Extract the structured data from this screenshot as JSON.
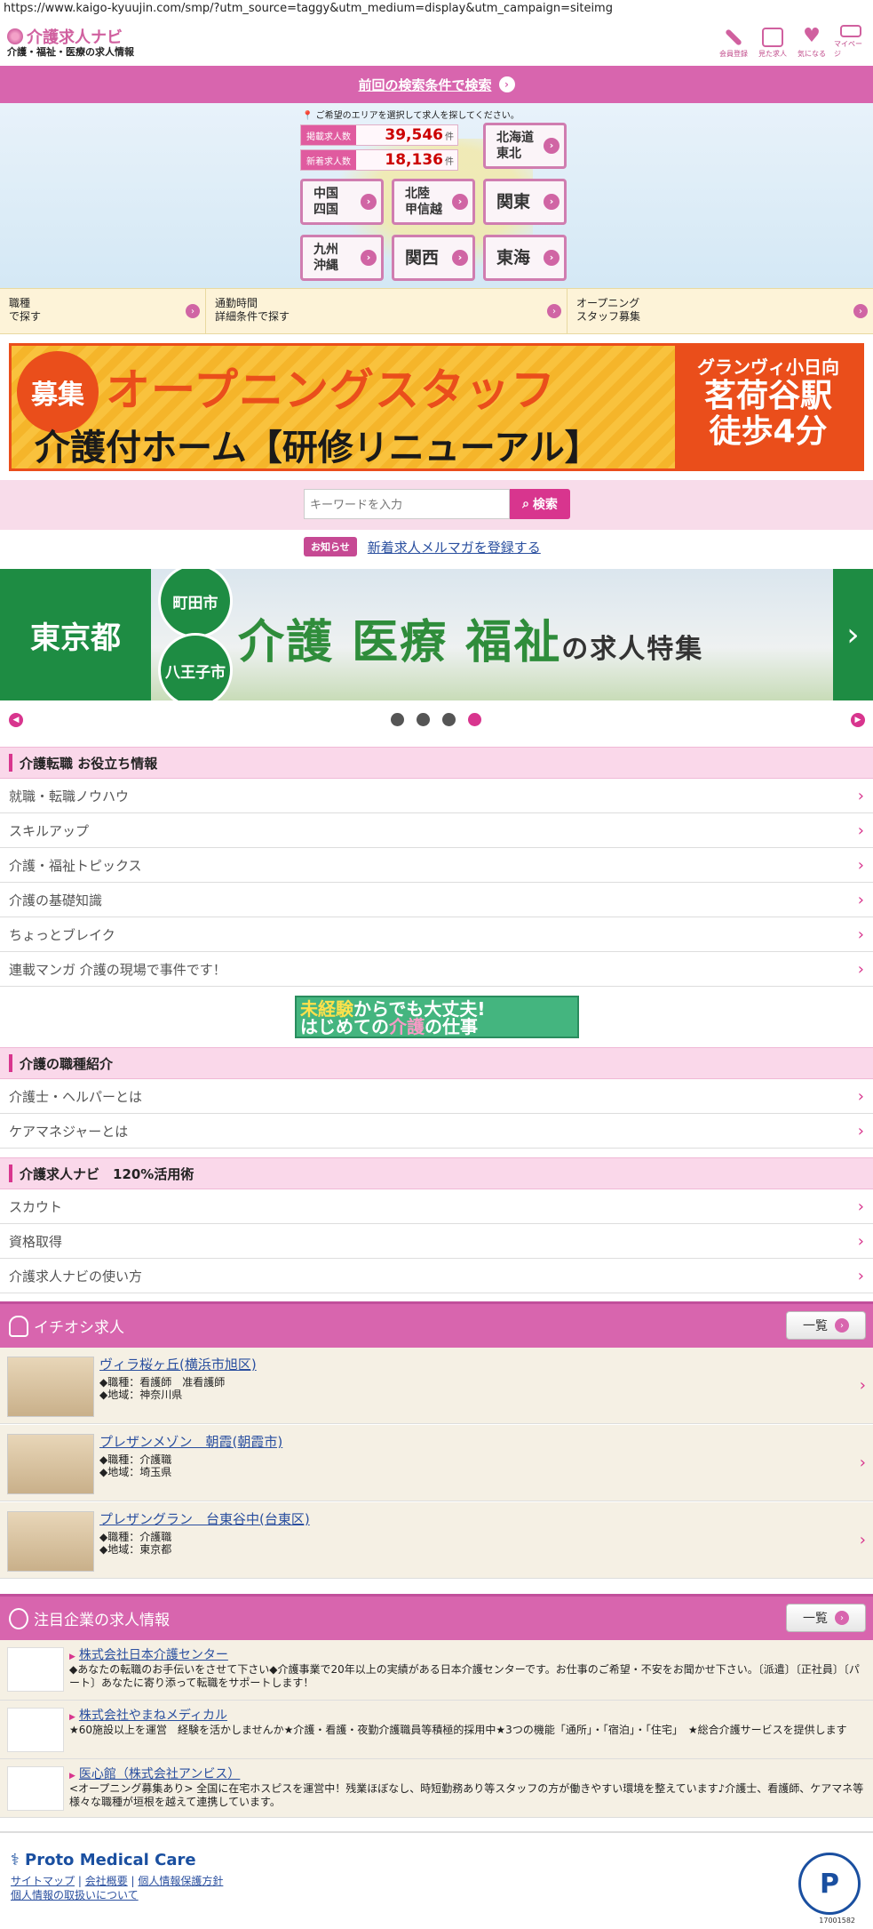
{
  "url": "https://www.kaigo-kyuujin.com/smp/?utm_source=taggy&utm_medium=display&utm_campaign=siteimg",
  "header": {
    "logo": "介護求人ナビ",
    "subtitle": "介護・福祉・医療の求人情報",
    "icons": [
      {
        "label": "会員登録",
        "icon": "pencil-icon"
      },
      {
        "label": "見た求人",
        "icon": "calendar-icon"
      },
      {
        "label": "気になる",
        "icon": "heart-icon"
      },
      {
        "label": "マイページ",
        "icon": "mypage-icon"
      }
    ]
  },
  "prev_search": "前回の検索条件で検索",
  "map": {
    "note": "ご希望のエリアを選択して求人を探してください。",
    "counts": [
      {
        "label": "掲載求人数",
        "value": "39,546",
        "unit": "件"
      },
      {
        "label": "新着求人数",
        "value": "18,136",
        "unit": "件"
      }
    ],
    "regions": [
      "北海道\n東北",
      "中国\n四国",
      "北陸\n甲信越",
      "関東",
      "九州\n沖縄",
      "関西",
      "東海"
    ]
  },
  "tabs": [
    {
      "label": "職種\nで探す"
    },
    {
      "label": "通勤時間\n詳細条件で探す"
    },
    {
      "label": "オープニング\nスタッフ募集"
    }
  ],
  "banner1": {
    "badge": "募集",
    "line1": "オープニングスタッフ",
    "line2": "介護付ホーム【研修リニューアル】",
    "right1": "グランヴィ小日向",
    "right2": "茗荷谷駅\n徒歩4分"
  },
  "search": {
    "placeholder": "キーワードを入力",
    "button": "検索"
  },
  "notice": {
    "badge": "お知らせ",
    "link": "新着求人メルマガを登録する"
  },
  "banner2": {
    "left": "東京都",
    "city1": "町田市",
    "city2": "八王子市",
    "title": "介護 医療 福祉",
    "suffix": "の求人特集"
  },
  "carousel": {
    "dots": 4,
    "active": 3
  },
  "section1": {
    "title": "介護転職 お役立ち情報",
    "items": [
      "就職・転職ノウハウ",
      "スキルアップ",
      "介護・福祉トピックス",
      "介護の基礎知識",
      "ちょっとブレイク",
      "連載マンガ 介護の現場で事件です！"
    ]
  },
  "minibanner": {
    "l1a": "未経験",
    "l1b": "からでも大丈夫!",
    "l2a": "はじめての",
    "l2b": "介護",
    "l2c": "の仕事"
  },
  "section2": {
    "title": "介護の職種紹介",
    "items": [
      "介護士・ヘルパーとは",
      "ケアマネジャーとは"
    ]
  },
  "section3": {
    "title": "介護求人ナビ　120%活用術",
    "items": [
      "スカウト",
      "資格取得",
      "介護求人ナビの使い方"
    ]
  },
  "featured": {
    "title": "イチオシ求人",
    "more": "一覧",
    "jobs": [
      {
        "title": "ヴィラ桜ヶ丘(横浜市旭区)",
        "type": "◆職種：看護師　准看護師",
        "area": "◆地域：神奈川県"
      },
      {
        "title": "プレザンメゾン　朝霞(朝霞市)",
        "type": "◆職種：介護職",
        "area": "◆地域：埼玉県"
      },
      {
        "title": "プレザングラン　台東谷中(台東区)",
        "type": "◆職種：介護職",
        "area": "◆地域：東京都"
      }
    ]
  },
  "companies": {
    "title": "注目企業の求人情報",
    "more": "一覧",
    "list": [
      {
        "name": "株式会社日本介護センター",
        "desc": "◆あなたの転職のお手伝いをさせて下さい◆介護事業で20年以上の実績がある日本介護センターです。お仕事のご希望・不安をお聞かせ下さい。〔派遣〕〔正社員〕〔パート〕あなたに寄り添って転職をサポートします！"
      },
      {
        "name": "株式会社やまねメディカル",
        "desc": "★60施設以上を運営　経験を活かしませんか★介護・看護・夜勤介護職員等積極的採用中★3つの機能「通所」・「宿泊」・「住宅」　★総合介護サービスを提供します"
      },
      {
        "name": "医心館（株式会社アンビス）",
        "desc": "<オープニング募集あり> 全国に在宅ホスピスを運営中！残業ほぼなし、時短勤務あり等スタッフの方が働きやすい環境を整えています♪介護士、看護師、ケアマネ等様々な職種が垣根を越えて連携しています。"
      }
    ]
  },
  "footer": {
    "brand": "Proto Medical Care",
    "links": [
      "サイトマップ",
      "会社概要",
      "個人情報保護方針",
      "個人情報の取扱いについて"
    ],
    "pmark_no": "17001582"
  },
  "colors": {
    "brand_pink": "#d865ae",
    "accent": "#d8358e",
    "link": "#2a4f9f"
  }
}
